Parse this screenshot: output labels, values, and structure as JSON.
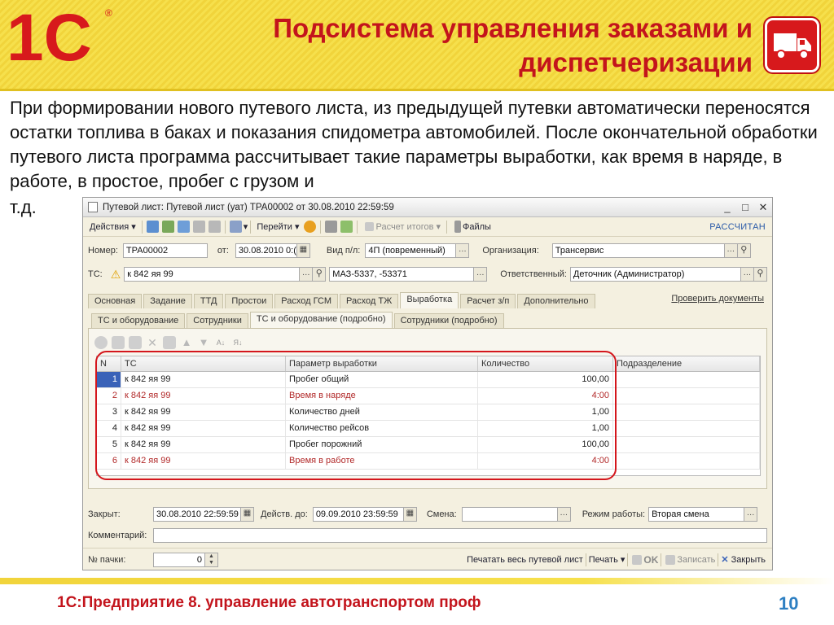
{
  "slide": {
    "logo_text": "1С",
    "title_line1": "Подсистема управления заказами и",
    "title_line2": "диспетчеризации",
    "intro": "При формировании нового путевого листа, из предыдущей путевки автоматически переносятся остатки топлива в баках и показания спидометра автомобилей. После окончательной обработки путевого листа программа рассчитывает такие параметры выработки, как время в наряде, в работе, в простое, пробег с грузом и",
    "intro_tail": "т.д.",
    "footer": "1С:Предприятие 8. управление автотранспортом проф",
    "page_number": "10"
  },
  "window": {
    "title": "Путевой лист: Путевой лист (уат) ТРА00002 от 30.08.2010 22:59:59",
    "controls": [
      "_",
      "□",
      "✕"
    ],
    "toolbar": {
      "actions": "Действия",
      "goto": "Перейти",
      "calc_totals": "Расчет итогов",
      "files": "Файлы",
      "status": "РАССЧИТАН"
    },
    "header_fields": {
      "number_label": "Номер:",
      "number_value": "ТРА00002",
      "from_label": "от:",
      "from_value": "30.08.2010 0:(",
      "type_label": "Вид п/л:",
      "type_value": "4П (повременный)",
      "org_label": "Организация:",
      "org_value": "Трансервис",
      "ts_label": "ТС:",
      "ts_value": "к 842 яя 99",
      "model_value": "МАЗ-5337, -53371",
      "resp_label": "Ответственный:",
      "resp_value": "Деточник (Администратор)"
    },
    "tabs": [
      "Основная",
      "Задание",
      "ТТД",
      "Простои",
      "Расход ГСМ",
      "Расход ТЖ",
      "Выработка",
      "Расчет з/п",
      "Дополнительно"
    ],
    "active_tab": "Выработка",
    "check_docs": "Проверить документы",
    "subtabs": [
      "ТС и оборудование",
      "Сотрудники",
      "ТС и оборудование (подробно)",
      "Сотрудники (подробно)"
    ],
    "active_subtab": "ТС и оборудование (подробно)",
    "table": {
      "columns": [
        "N",
        "ТС",
        "Параметр выработки",
        "Количество",
        "Подразделение"
      ],
      "rows": [
        {
          "n": "1",
          "ts": "к 842 яя 99",
          "param": "Пробег общий",
          "qty": "100,00",
          "dept": "",
          "highlight": false
        },
        {
          "n": "2",
          "ts": "к 842 яя 99",
          "param": "Время в наряде",
          "qty": "4:00",
          "dept": "",
          "highlight": true
        },
        {
          "n": "3",
          "ts": "к 842 яя 99",
          "param": "Количество дней",
          "qty": "1,00",
          "dept": "",
          "highlight": false
        },
        {
          "n": "4",
          "ts": "к 842 яя 99",
          "param": "Количество рейсов",
          "qty": "1,00",
          "dept": "",
          "highlight": false
        },
        {
          "n": "5",
          "ts": "к 842 яя 99",
          "param": "Пробег порожний",
          "qty": "100,00",
          "dept": "",
          "highlight": false
        },
        {
          "n": "6",
          "ts": "к 842 яя 99",
          "param": "Время в работе",
          "qty": "4:00",
          "dept": "",
          "highlight": true
        }
      ]
    },
    "bottom_fields": {
      "closed_label": "Закрыт:",
      "closed_value": "30.08.2010 22:59:59",
      "valid_label": "Действ. до:",
      "valid_value": "09.09.2010 23:59:59",
      "shift_label": "Смена:",
      "shift_value": "",
      "mode_label": "Режим работы:",
      "mode_value": "Вторая смена",
      "comment_label": "Комментарий:",
      "comment_value": "",
      "pack_label": "№ пачки:",
      "pack_value": "0"
    },
    "footer_buttons": {
      "print_all": "Печатать весь путевой лист",
      "print": "Печать",
      "ok": "OK",
      "save": "Записать",
      "close": "Закрыть"
    }
  },
  "colors": {
    "accent_red": "#c3141c",
    "header_yellow": "#f6e04c",
    "selection_blue": "#3a62b8",
    "page_number_blue": "#2d7fc2"
  }
}
